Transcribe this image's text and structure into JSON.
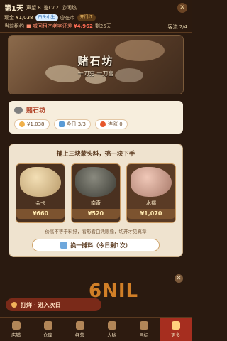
{
  "status": {
    "day": "第1天",
    "reputation": "声望 8",
    "appraise": "鉴Lv.2",
    "mood": "@闲热",
    "tag_blue": "白头小生",
    "tag_gold": "开门红",
    "cash_label": "现金",
    "cash": "¥1,038",
    "debt_label": "当前租约",
    "notice": "@在市",
    "alert": "■ 喊回租产老宅还差",
    "debt_amount": "¥4,962",
    "days_left": "剩25天",
    "guest": "客流 2/4",
    "close": "✕"
  },
  "hero": {
    "title": "赌石坊",
    "subtitle": "一刀穷  一刀富"
  },
  "section": {
    "title": "赌石坊",
    "chips": [
      "¥1,038",
      "今日 3/3",
      "连涨 0"
    ]
  },
  "panel": {
    "title": "捕上三块蒙头料，挑一块下手",
    "cards": [
      {
        "name": "会卡",
        "price": "¥660"
      },
      {
        "name": "南奇",
        "price": "¥520"
      },
      {
        "name": "水都",
        "price": "¥1,070"
      }
    ],
    "hint": "价高不等于料好，看形看白凭眼缘，切开才见真章",
    "swap_label": "换一摊料（今日剩1次）"
  },
  "footer": {
    "button": "打烊 · 进入次日"
  },
  "tabs": [
    {
      "label": "店铺"
    },
    {
      "label": "仓库"
    },
    {
      "label": "经营"
    },
    {
      "label": "人脉"
    },
    {
      "label": "目标"
    },
    {
      "label": "更多"
    }
  ],
  "watermark": "6NIL"
}
